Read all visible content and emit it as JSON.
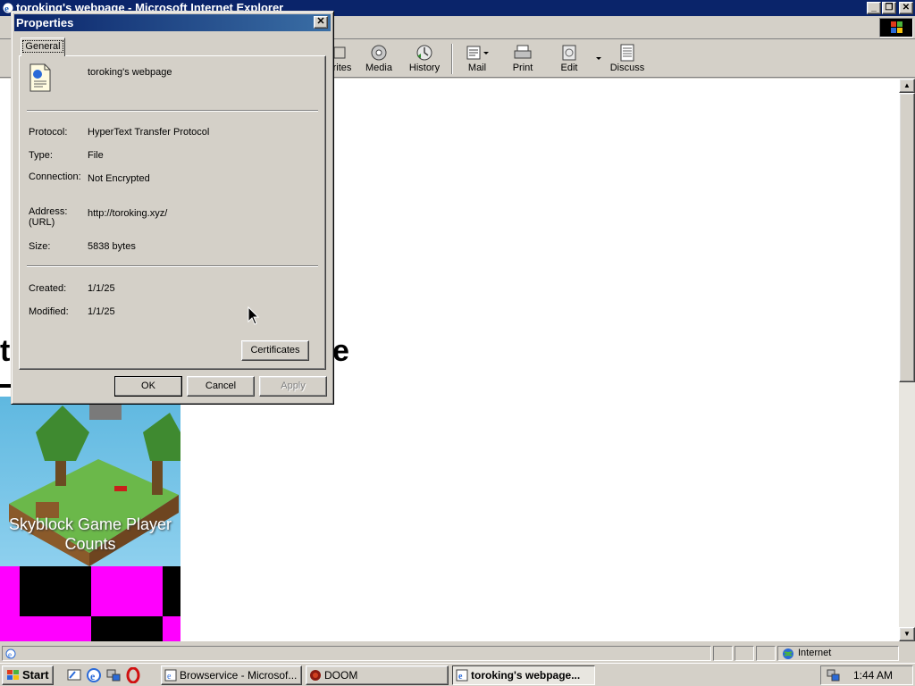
{
  "window": {
    "title": "toroking's webpage - Microsoft Internet Explorer"
  },
  "toolbar": {
    "buttons": [
      {
        "label": "rites",
        "icon": "favorites-icon"
      },
      {
        "label": "Media",
        "icon": "media-icon"
      },
      {
        "label": "History",
        "icon": "history-icon"
      },
      {
        "label": "Mail",
        "icon": "mail-icon"
      },
      {
        "label": "Print",
        "icon": "print-icon"
      },
      {
        "label": "Edit",
        "icon": "edit-icon"
      },
      {
        "label": "Discuss",
        "icon": "discuss-icon"
      }
    ]
  },
  "page": {
    "heading_left": "t",
    "heading_right": "e",
    "card_caption": "Skyblock Game Player Counts"
  },
  "dialog": {
    "title": "Properties",
    "tab": "General",
    "name": "toroking's webpage",
    "fields": {
      "protocol_label": "Protocol:",
      "protocol_value": "HyperText Transfer Protocol",
      "type_label": "Type:",
      "type_value": "File",
      "connection_label": "Connection:",
      "connection_value": "Not Encrypted",
      "address_label": "Address: (URL)",
      "address_value": "http://toroking.xyz/",
      "size_label": "Size:",
      "size_value": "5838 bytes",
      "created_label": "Created:",
      "created_value": "1/1/25",
      "modified_label": "Modified:",
      "modified_value": "1/1/25"
    },
    "certificates_label": "Certificates",
    "ok_label": "OK",
    "cancel_label": "Cancel",
    "apply_label": "Apply"
  },
  "statusbar": {
    "zone": "Internet"
  },
  "taskbar": {
    "start_label": "Start",
    "tasks": [
      {
        "label": "Browservice - Microsof..."
      },
      {
        "label": "DOOM"
      },
      {
        "label": "toroking's webpage..."
      }
    ],
    "clock": "1:44 AM"
  },
  "colors": {
    "titlebar": "#0a246a",
    "magenta": "#ff00ff",
    "desktop_gray": "#d4d0c8"
  }
}
